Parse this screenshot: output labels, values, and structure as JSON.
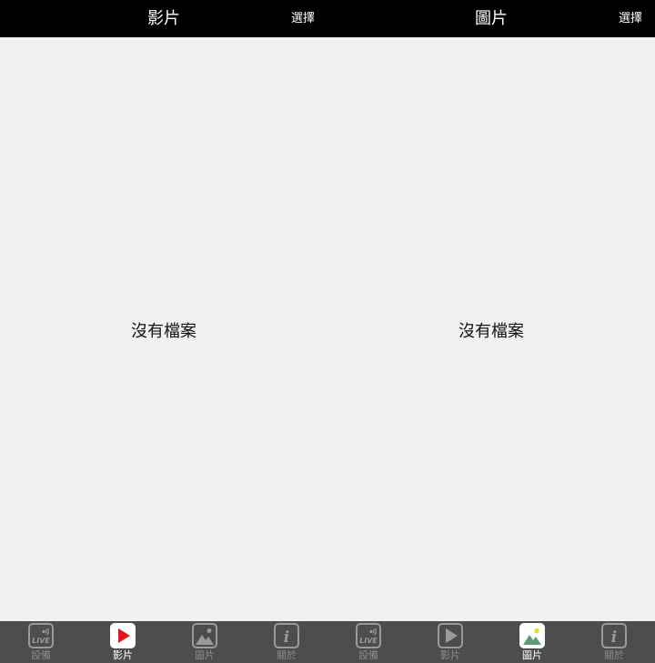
{
  "colors": {
    "topbar_bg": "#000000",
    "content_bg": "#f1f1f1",
    "tabbar_bg": "#4d4d4d",
    "tab_inactive": "#8c8c8c",
    "tab_active_label": "#ffffff",
    "play_accent": "#e3141c",
    "image_mountain": "#5e9a74",
    "image_sun": "#e8e01e"
  },
  "panels": [
    {
      "title": "影片",
      "select_label": "選擇",
      "empty_text": "沒有檔案",
      "active_tab": "tab-videos",
      "tabs": [
        {
          "label": "設備",
          "icon": "live-icon"
        },
        {
          "label": "影片",
          "icon": "play-icon"
        },
        {
          "label": "圖片",
          "icon": "image-icon"
        },
        {
          "label": "關於",
          "icon": "info-icon"
        }
      ]
    },
    {
      "title": "圖片",
      "select_label": "選擇",
      "empty_text": "沒有檔案",
      "active_tab": "tab-pictures",
      "tabs": [
        {
          "label": "設備",
          "icon": "live-icon"
        },
        {
          "label": "影片",
          "icon": "play-icon"
        },
        {
          "label": "圖片",
          "icon": "image-icon"
        },
        {
          "label": "關於",
          "icon": "info-icon"
        }
      ]
    }
  ]
}
